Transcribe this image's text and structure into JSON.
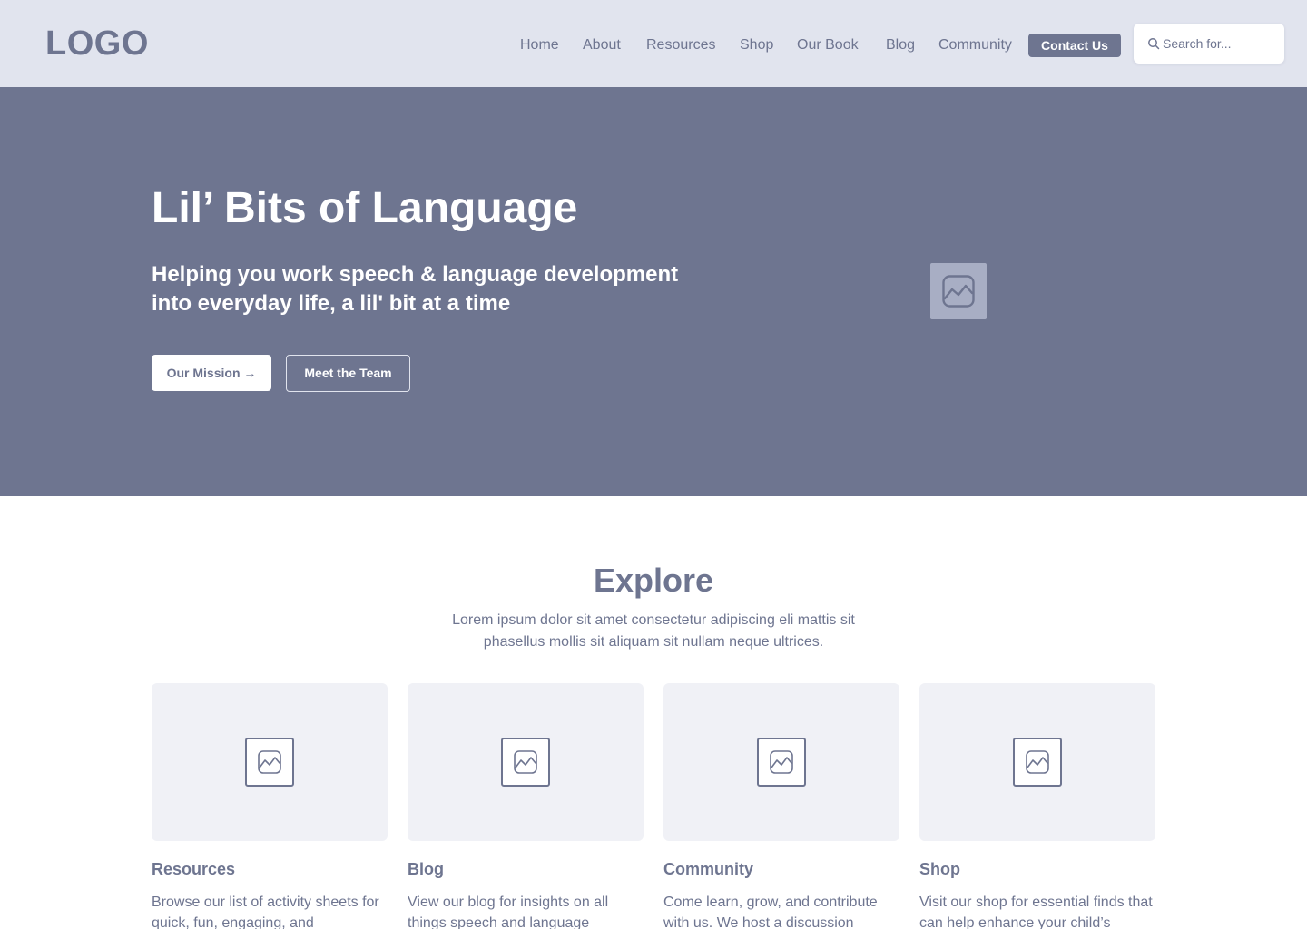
{
  "header": {
    "logo": "LOGO",
    "nav": [
      {
        "label": "Home"
      },
      {
        "label": "About"
      },
      {
        "label": "Resources"
      },
      {
        "label": "Shop"
      },
      {
        "label": "Our Book"
      },
      {
        "label": "Blog"
      },
      {
        "label": "Community"
      }
    ],
    "contact_label": "Contact Us",
    "search_placeholder": "Search for..."
  },
  "hero": {
    "title": "Lil’ Bits of Language",
    "subtitle": "Helping you work speech & language development into everyday life, a lil' bit at a time",
    "primary_button": "Our Mission →",
    "secondary_button": "Meet the Team"
  },
  "explore": {
    "title": "Explore",
    "description": "Lorem ipsum dolor sit amet consectetur adipiscing eli mattis sit phasellus mollis sit aliquam sit nullam neque ultrices.",
    "cards": [
      {
        "title": "Resources",
        "text": "Browse our list of activity sheets for quick, fun, engaging, and"
      },
      {
        "title": "Blog",
        "text": "View our blog for insights on all things speech and language"
      },
      {
        "title": "Community",
        "text": "Come learn, grow, and contribute with us. We host a discussion"
      },
      {
        "title": "Shop",
        "text": "Visit our shop for essential finds that can help enhance your child’s"
      }
    ]
  },
  "colors": {
    "primary": "#6e7590",
    "header_bg": "#e1e4ee",
    "card_bg": "#f0f1f6",
    "white": "#ffffff"
  }
}
